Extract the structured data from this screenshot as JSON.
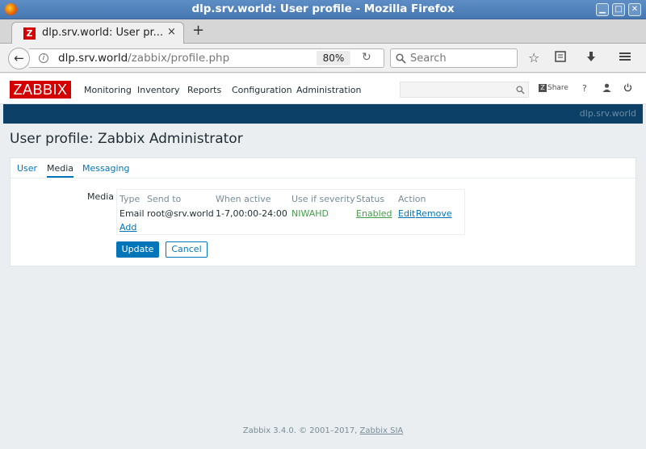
{
  "window": {
    "title": "dlp.srv.world: User profile - Mozilla Firefox",
    "minimize": "▁",
    "maximize": "□",
    "close": "✕"
  },
  "browser": {
    "tab_title": "dlp.srv.world: User pr...",
    "tab_close": "×",
    "new_tab": "+",
    "url_host": "dlp.srv.world",
    "url_path": "/zabbix/profile.php",
    "url_scheme_prefix": "",
    "zoom": "80%",
    "search_placeholder": "Search",
    "icons": [
      "back-arrow-icon",
      "info-icon",
      "reload-icon",
      "search-icon",
      "star-icon",
      "reading-list-icon",
      "download-icon",
      "menu-icon"
    ]
  },
  "zabbix": {
    "logo": "ZABBIX",
    "menu": [
      "Monitoring",
      "Inventory",
      "Reports",
      "Configuration",
      "Administration"
    ],
    "share_label": "Share",
    "help_label": "?",
    "server_name": "dlp.srv.world",
    "page_title": "User profile: Zabbix Administrator",
    "tabs": [
      "User",
      "Media",
      "Messaging"
    ],
    "active_tab": "Media",
    "media": {
      "label": "Media",
      "columns": [
        "Type",
        "Send to",
        "When active",
        "Use if severity",
        "Status",
        "Action"
      ],
      "rows": [
        {
          "type": "Email",
          "send_to": "root@srv.world",
          "when_active": "1-7,00:00-24:00",
          "severity": "NIWAHD",
          "status": "Enabled",
          "action_edit": "Edit",
          "action_remove": "Remove"
        }
      ],
      "add_label": "Add"
    },
    "buttons": {
      "update": "Update",
      "cancel": "Cancel"
    },
    "footer": {
      "text": "Zabbix 3.4.0. © 2001–2017,",
      "link": "Zabbix SIA"
    },
    "colors": {
      "brand_red": "#d40000",
      "accent_blue": "#0275b8",
      "dark_bar": "#0c4066",
      "ok_green": "#429e47"
    }
  }
}
